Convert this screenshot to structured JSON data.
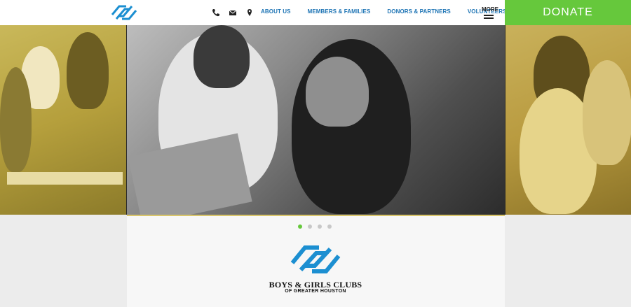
{
  "header": {
    "nav": [
      {
        "label": "ABOUT US"
      },
      {
        "label": "MEMBERS & FAMILIES"
      },
      {
        "label": "DONORS & PARTNERS"
      },
      {
        "label": "VOLUNTEERS"
      }
    ],
    "more_label": "MORE",
    "donate_label": "DONATE",
    "contact_icons": [
      "phone-icon",
      "email-icon",
      "location-icon"
    ]
  },
  "colors": {
    "nav_link": "#1c73b4",
    "donate_bg": "#66c83c",
    "logo_blue": "#1c8fd1",
    "active_dot": "#66c83c"
  },
  "carousel": {
    "slide_count": 4,
    "active_index": 0
  },
  "organization": {
    "name": "BOYS & GIRLS CLUBS",
    "subtitle": "OF GREATER HOUSTON"
  }
}
